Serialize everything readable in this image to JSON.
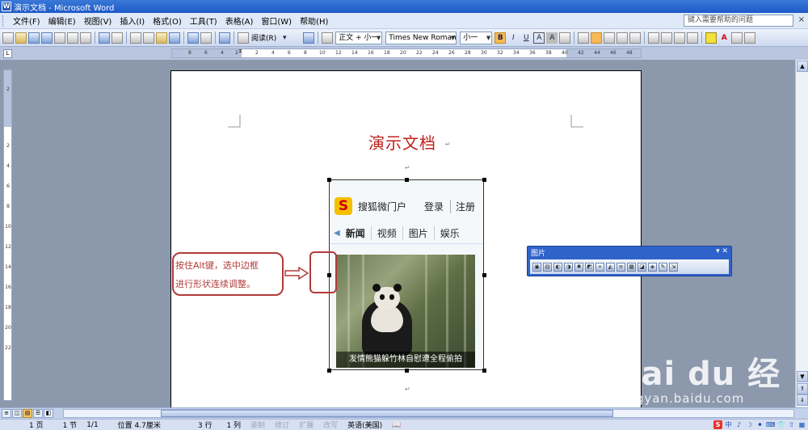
{
  "window": {
    "title": "演示文档 - Microsoft Word"
  },
  "menu": {
    "items": [
      "文件(F)",
      "编辑(E)",
      "视图(V)",
      "插入(I)",
      "格式(O)",
      "工具(T)",
      "表格(A)",
      "窗口(W)",
      "帮助(H)"
    ],
    "help_placeholder": "键入需要帮助的问题",
    "close_glyph": "×"
  },
  "toolbar": {
    "read_label": "阅读(R)",
    "style_value": "正文 + 小一",
    "font_value": "Times New Roman",
    "size_value": "小一",
    "bold": "B",
    "italic": "I",
    "underline": "U",
    "char_border": "A",
    "char_shading": "A"
  },
  "ruler": {
    "corner": "L",
    "ticks": [
      "8",
      "6",
      "4",
      "2",
      "",
      "2",
      "4",
      "6",
      "8",
      "10",
      "12",
      "14",
      "16",
      "18",
      "20",
      "22",
      "24",
      "26",
      "28",
      "30",
      "32",
      "34",
      "36",
      "38",
      "40",
      "42",
      "44",
      "46",
      "48"
    ],
    "vticks": [
      "2",
      "",
      "2",
      "4",
      "6",
      "8",
      "10",
      "12",
      "14",
      "16",
      "18",
      "20",
      "22"
    ]
  },
  "document": {
    "title": "演示文档",
    "para_mark": "↵"
  },
  "embed": {
    "logo": "S",
    "portal": "搜狐微门户",
    "login": "登录",
    "register": "注册",
    "nav_arrow": "◀",
    "tabs": [
      "新闻",
      "视频",
      "图片",
      "娱乐"
    ],
    "caption": "发情熊猫躲竹林自慰遭全程偷拍"
  },
  "annotation": {
    "line1": "按住Alt键，选中边框",
    "line2": "进行形状连续调整。"
  },
  "picture_toolbar": {
    "title": "图片",
    "controls": "▾ ✕",
    "buttons": [
      "▣",
      "▤",
      "◐",
      "◑",
      "✺",
      "◩",
      "⌖",
      "◭",
      "≡",
      "▦",
      "◪",
      "◈",
      "✎",
      "⇲"
    ]
  },
  "watermark": {
    "brand": "Bai du 经验",
    "url": "jingyan.baidu.com"
  },
  "status": {
    "page": "1 页",
    "section": "1 节",
    "page_of": "1/1",
    "position": "位置 4.7厘米",
    "line": "3 行",
    "column": "1 列",
    "rec": "录制",
    "trk": "修订",
    "ext": "扩展",
    "ovr": "改写",
    "language": "英语(美国)"
  },
  "tray": {
    "ime": "S",
    "items": [
      "中",
      "♪",
      "☽",
      "⚫",
      "⌨",
      "👕",
      "⇧",
      "▦"
    ]
  }
}
